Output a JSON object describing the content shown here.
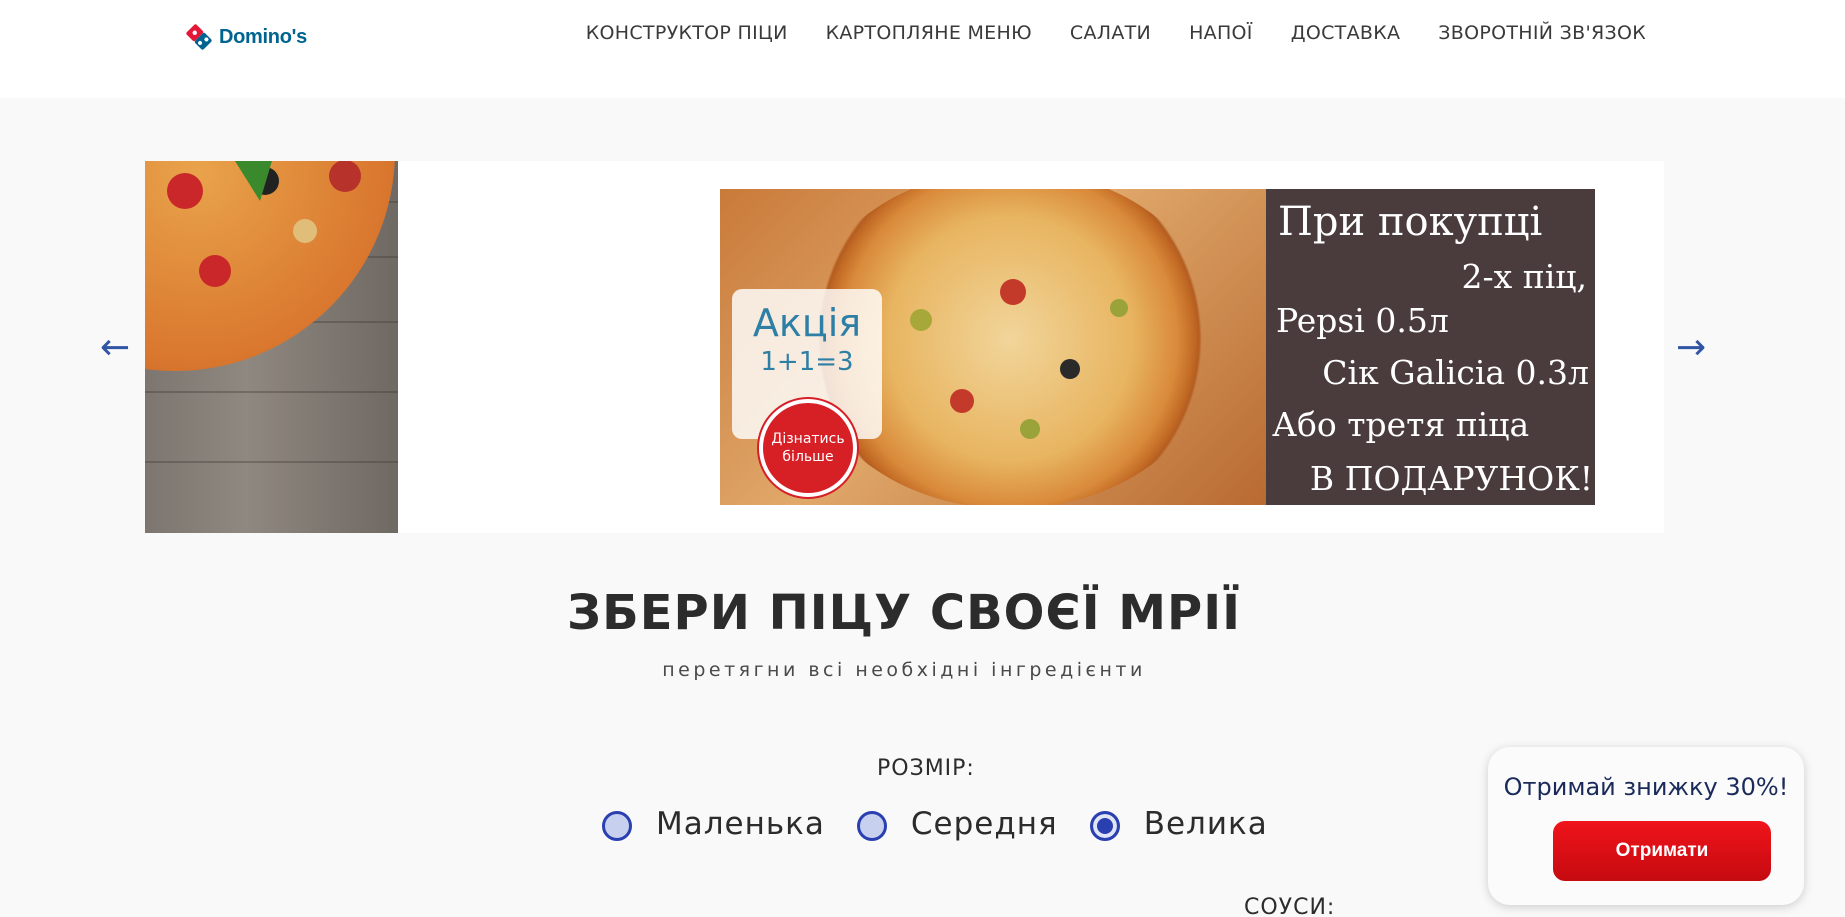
{
  "brand": {
    "name": "Domino's"
  },
  "nav": [
    {
      "label": "КОНСТРУКТОР ПІЦИ"
    },
    {
      "label": "КАРТОПЛЯНЕ МЕНЮ"
    },
    {
      "label": "САЛАТИ"
    },
    {
      "label": "НАПОЇ"
    },
    {
      "label": "ДОСТАВКА"
    },
    {
      "label": "ЗВОРОТНІЙ ЗВ'ЯЗОК"
    }
  ],
  "slider": {
    "prev": "←",
    "next": "→",
    "promo": {
      "badge_title": "Акція",
      "badge_sub": "1+1=3",
      "badge_button": "Дізнатись більше",
      "lines": [
        "При покупці",
        "2-х піц,",
        "Pepsi 0.5л",
        "Сік Galicia 0.3л",
        "Або третя піца",
        "В ПОДАРУНОК!"
      ]
    }
  },
  "builder": {
    "title": "ЗБЕРИ ПІЦУ СВОЄЇ МРІЇ",
    "subtitle": "перетягни всі необхідні інгредієнти",
    "size_label": "РОЗМІР:",
    "sizes": [
      {
        "label": "Маленька",
        "checked": false
      },
      {
        "label": "Середня",
        "checked": false
      },
      {
        "label": "Велика",
        "checked": true
      }
    ],
    "sauces_label": "СОУСИ:"
  },
  "popup": {
    "title": "Отримай знижку 30%!",
    "button": "Отримати"
  },
  "colors": {
    "brand_blue": "#006491",
    "brand_red": "#e31837",
    "accent_blue": "#2a3fb0",
    "cta_red": "#e0111a"
  }
}
